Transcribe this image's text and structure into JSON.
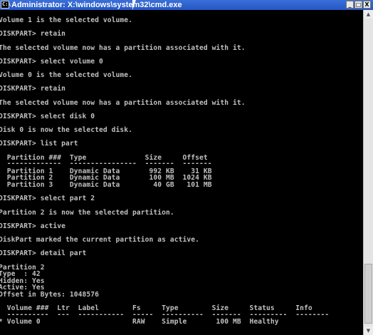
{
  "window": {
    "title": "Administrator: X:\\windows\\system32\\cmd.exe",
    "minimize_glyph": "_",
    "maximize_glyph": "□",
    "close_glyph": "X",
    "icon_glyph": "C:\\"
  },
  "console": {
    "lines": [
      "Volume 1 is the selected volume.",
      "DISKPART> retain",
      "The selected volume now has a partition associated with it.",
      "DISKPART> select volume 0",
      "Volume 0 is the selected volume.",
      "DISKPART> retain",
      "The selected volume now has a partition associated with it.",
      "DISKPART> select disk 0",
      "Disk 0 is now the selected disk.",
      "DISKPART> list part",
      "  Partition ###  Type              Size     Offset",
      "  -------------  ----------------  -------  -------",
      "  Partition 1    Dynamic Data       992 KB    31 KB",
      "  Partition 2    Dynamic Data       100 MB  1024 KB",
      "  Partition 3    Dynamic Data        40 GB   101 MB",
      "DISKPART> select part 2",
      "Partition 2 is now the selected partition.",
      "DISKPART> active",
      "DiskPart marked the current partition as active.",
      "DISKPART> detail part",
      "Partition 2",
      "Type  : 42",
      "Hidden: Yes",
      "Active: Yes",
      "Offset in Bytes: 1048576",
      "  Volume ###  Ltr  Label        Fs     Type        Size     Status     Info",
      "  ----------  ---  -----------  -----  ----------  -------  ---------  --------",
      "* Volume 0                      RAW    Simple       100 MB  Healthy"
    ]
  },
  "scrollbar": {
    "up_glyph": "▲",
    "down_glyph": "▼"
  }
}
